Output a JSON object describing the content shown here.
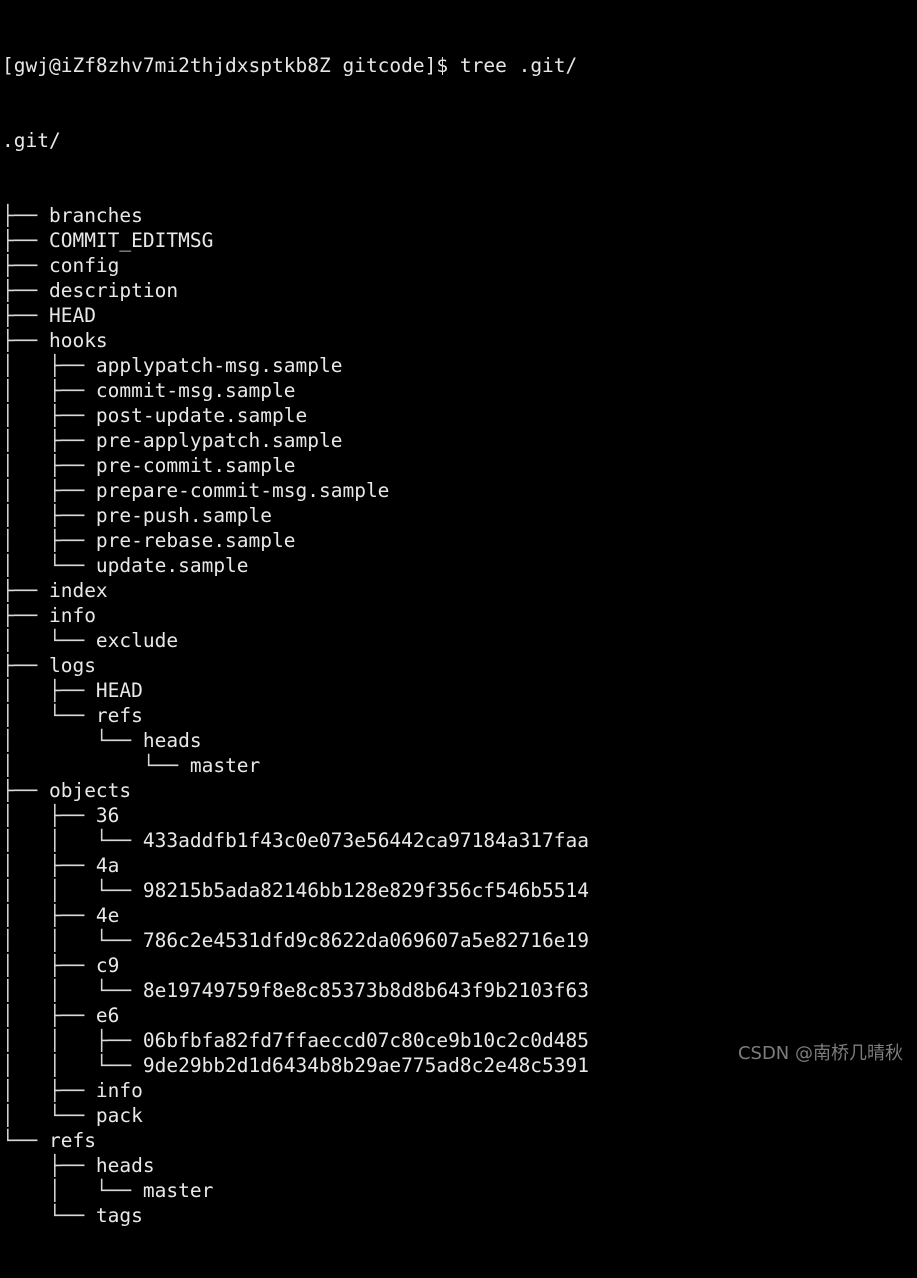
{
  "terminal": {
    "prompt": "[gwj@iZf8zhv7mi2thjdxsptkb8Z gitcode]$ ",
    "command": "tree .git/",
    "root": ".git/",
    "glyphs": {
      "tee": "├── ",
      "last": "└── ",
      "pipe": "│   ",
      "blank": "    "
    }
  },
  "watermark": "CSDN @南桥几晴秋",
  "tree_lines": [
    {
      "prefix": "├── ",
      "name": "branches",
      "indent": ""
    },
    {
      "prefix": "├── ",
      "name": "COMMIT_EDITMSG",
      "indent": ""
    },
    {
      "prefix": "├── ",
      "name": "config",
      "indent": ""
    },
    {
      "prefix": "├── ",
      "name": "description",
      "indent": ""
    },
    {
      "prefix": "├── ",
      "name": "HEAD",
      "indent": ""
    },
    {
      "prefix": "├── ",
      "name": "hooks",
      "indent": ""
    },
    {
      "prefix": "├── ",
      "name": "applypatch-msg.sample",
      "indent": "│   "
    },
    {
      "prefix": "├── ",
      "name": "commit-msg.sample",
      "indent": "│   "
    },
    {
      "prefix": "├── ",
      "name": "post-update.sample",
      "indent": "│   "
    },
    {
      "prefix": "├── ",
      "name": "pre-applypatch.sample",
      "indent": "│   "
    },
    {
      "prefix": "├── ",
      "name": "pre-commit.sample",
      "indent": "│   "
    },
    {
      "prefix": "├── ",
      "name": "prepare-commit-msg.sample",
      "indent": "│   "
    },
    {
      "prefix": "├── ",
      "name": "pre-push.sample",
      "indent": "│   "
    },
    {
      "prefix": "├── ",
      "name": "pre-rebase.sample",
      "indent": "│   "
    },
    {
      "prefix": "└── ",
      "name": "update.sample",
      "indent": "│   "
    },
    {
      "prefix": "├── ",
      "name": "index",
      "indent": ""
    },
    {
      "prefix": "├── ",
      "name": "info",
      "indent": ""
    },
    {
      "prefix": "└── ",
      "name": "exclude",
      "indent": "│   "
    },
    {
      "prefix": "├── ",
      "name": "logs",
      "indent": ""
    },
    {
      "prefix": "├── ",
      "name": "HEAD",
      "indent": "│   "
    },
    {
      "prefix": "└── ",
      "name": "refs",
      "indent": "│   "
    },
    {
      "prefix": "└── ",
      "name": "heads",
      "indent": "│       "
    },
    {
      "prefix": "└── ",
      "name": "master",
      "indent": "│           "
    },
    {
      "prefix": "├── ",
      "name": "objects",
      "indent": ""
    },
    {
      "prefix": "├── ",
      "name": "36",
      "indent": "│   "
    },
    {
      "prefix": "└── ",
      "name": "433addfb1f43c0e073e56442ca97184a317faa",
      "indent": "│   │   "
    },
    {
      "prefix": "├── ",
      "name": "4a",
      "indent": "│   "
    },
    {
      "prefix": "└── ",
      "name": "98215b5ada82146bb128e829f356cf546b5514",
      "indent": "│   │   "
    },
    {
      "prefix": "├── ",
      "name": "4e",
      "indent": "│   "
    },
    {
      "prefix": "└── ",
      "name": "786c2e4531dfd9c8622da069607a5e82716e19",
      "indent": "│   │   "
    },
    {
      "prefix": "├── ",
      "name": "c9",
      "indent": "│   "
    },
    {
      "prefix": "└── ",
      "name": "8e19749759f8e8c85373b8d8b643f9b2103f63",
      "indent": "│   │   "
    },
    {
      "prefix": "├── ",
      "name": "e6",
      "indent": "│   "
    },
    {
      "prefix": "├── ",
      "name": "06bfbfa82fd7ffaeccd07c80ce9b10c2c0d485",
      "indent": "│   │   "
    },
    {
      "prefix": "└── ",
      "name": "9de29bb2d1d6434b8b29ae775ad8c2e48c5391",
      "indent": "│   │   "
    },
    {
      "prefix": "├── ",
      "name": "info",
      "indent": "│   "
    },
    {
      "prefix": "└── ",
      "name": "pack",
      "indent": "│   "
    },
    {
      "prefix": "└── ",
      "name": "refs",
      "indent": ""
    },
    {
      "prefix": "├── ",
      "name": "heads",
      "indent": "    "
    },
    {
      "prefix": "└── ",
      "name": "master",
      "indent": "    │   "
    },
    {
      "prefix": "└── ",
      "name": "tags",
      "indent": "    "
    }
  ]
}
